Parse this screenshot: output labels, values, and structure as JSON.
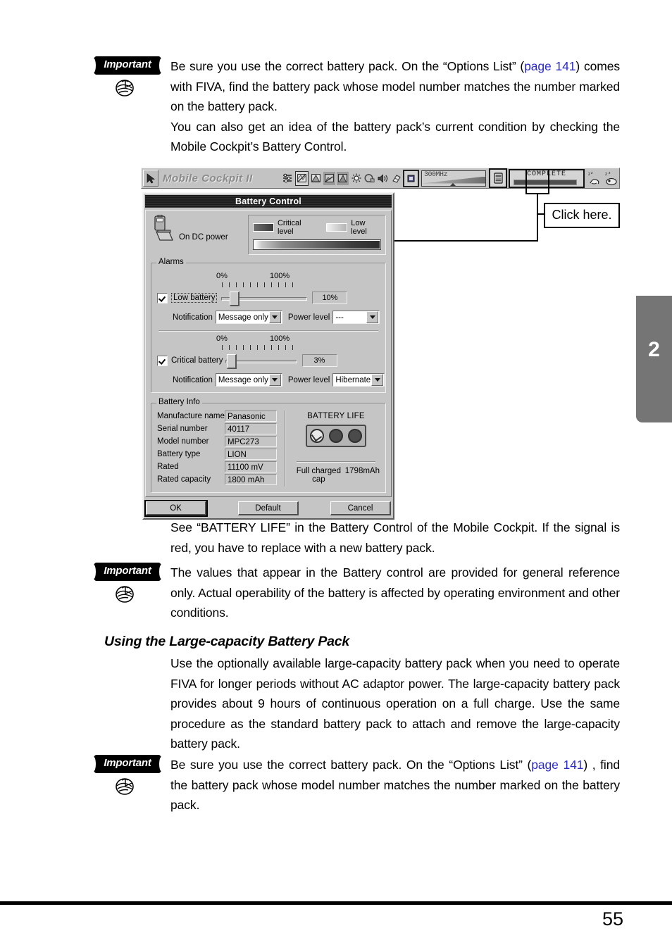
{
  "page": {
    "number": "55",
    "chapter_tab": "2"
  },
  "notes": {
    "important_label": "Important",
    "note1": {
      "line1_a": "Be sure you use the correct battery pack. On the “Options List” (",
      "link1": "page",
      "link2": "141",
      "line1_b": ") comes with FIVA, find the battery pack whose model number matches the number marked on the battery pack.",
      "para2": "You can also get an idea of the battery pack’s current condition by checking the Mobile Cockpit’s Battery Control."
    },
    "after_figure": "See “BATTERY LIFE” in the Battery Control of the Mobile Cockpit. If the signal is red, you have to replace with a new battery pack.",
    "note2": "The values that appear in the Battery control are provided for general reference only. Actual operability of the battery is affected by operating environment and other conditions.",
    "note3": {
      "line_a": "Be sure you use the correct battery pack. On the “Options List” (",
      "link1": "page",
      "link2": "141",
      "line_b": ") , find the battery pack whose model number matches the number marked on the battery pack."
    }
  },
  "section": {
    "heading": "Using the Large-capacity Battery Pack",
    "paragraph": "Use the optionally available large-capacity battery pack when you need to operate FIVA for longer periods without AC adaptor power. The large-capacity battery pack provides about 9 hours of continuous operation on a full charge. Use the same procedure as the standard battery pack to attach and remove the large-capacity battery pack."
  },
  "figure": {
    "toolbar": {
      "title": "Mobile Cockpit II",
      "cpu_speed": "300",
      "cpu_speed_unit": "MHz",
      "battery_status": "COMPLETE"
    },
    "callout": {
      "text": "Click here."
    },
    "dialog": {
      "caption": "Battery Control",
      "power_source": "On DC power",
      "legend": {
        "critical": "Critical level",
        "low": "Low level"
      },
      "alarms_group": "Alarms",
      "scale_min": "0%",
      "scale_max": "100%",
      "low_battery": {
        "label": "Low battery",
        "checked": true,
        "value": "10%",
        "notification_label": "Notification",
        "notification_value": "Message only",
        "power_level_label": "Power level",
        "power_level_value": "---"
      },
      "critical_battery": {
        "label": "Critical battery",
        "checked": true,
        "value": "3%",
        "notification_label": "Notification",
        "notification_value": "Message only",
        "power_level_label": "Power level",
        "power_level_value": "Hibernate"
      },
      "battery_info_group": "Battery Info",
      "battery_info": [
        {
          "label": "Manufacture name",
          "value": "Panasonic"
        },
        {
          "label": "Serial number",
          "value": "40117"
        },
        {
          "label": "Model number",
          "value": "MPC273"
        },
        {
          "label": "Battery type",
          "value": "LION"
        },
        {
          "label": "Rated",
          "value": "11100 mV"
        },
        {
          "label": "Rated capacity",
          "value": "1800 mAh"
        }
      ],
      "battery_life_title": "BATTERY LIFE",
      "full_charged_label": "Full charged cap",
      "full_charged_value": "1798mAh",
      "buttons": {
        "ok": "OK",
        "default": "Default",
        "cancel": "Cancel"
      }
    }
  }
}
